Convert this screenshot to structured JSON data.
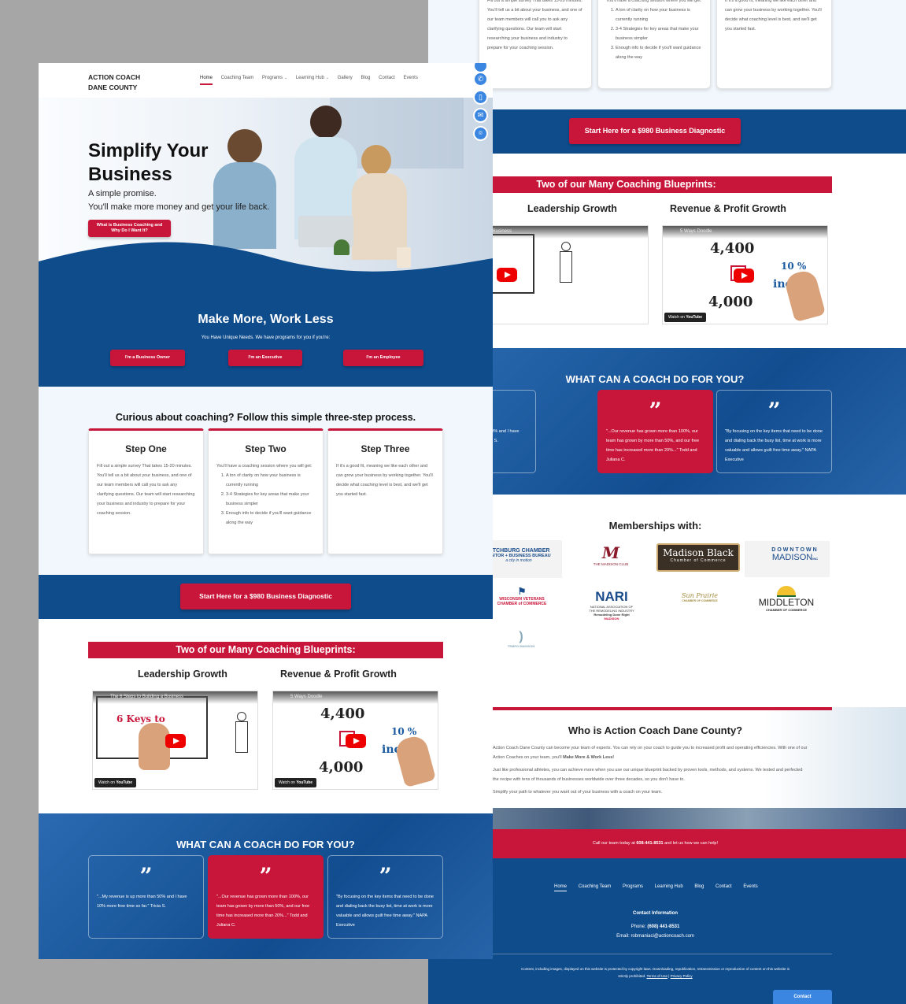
{
  "back": {
    "steps": {
      "step1_text": "Fill out a simple survey That takes 15-20 minutes. You'll tell us a bit about your business, and one of our team members will call you to ask any clarifying questions. Our team will start researching your business and industry to prepare for your coaching session.",
      "step2_intro": "You'll have a coaching session where you will get:",
      "step2_items": [
        "A ton of clarity on how your business is currently running",
        "3-4 Strategies for key areas that make your business simpler",
        "Enough info to decide if you'll want guidance along the way"
      ],
      "step3_text": "If it's a good fit, meaning we like each other and can grow your business by working together. You'll decide what coaching level is best, and we'll get you started fast."
    },
    "cta_button": "Start Here for a $980 Business Diagnostic",
    "blueprints_banner": "Two of our Many Coaching Blueprints:",
    "blueprint_1": "Leadership Growth",
    "blueprint_2": "Revenue & Profit Growth",
    "video1_title": "The 6 Steps to Building a Business",
    "video2_title": "5 Ways Doodle",
    "watch_on": "Watch on",
    "youtube": "YouTube",
    "video_text_keys": "6 Keys to",
    "video_num_top": "4,400",
    "video_num_bottom": "4,000",
    "video_pct": "10 %",
    "video_inc": "inc",
    "coach_heading": "WHAT CAN A COACH DO FOR YOU?",
    "quote1": "\"...My revenue is up more than 50% and I have 10% more free time so far.\" Tricia S.",
    "quote2": "\"...Our revenue has grown more than 100%, our team has grown by more than 50%, and our free time has increased more than 20%...\" Todd and Juliana C.",
    "quote3": "\"By focusing on the key items that need to be done and dialing back the busy list, time at work is more valuable and allows guilt free time away.\" NAPA Executive",
    "memberships_heading": "Memberships with:",
    "logos": [
      "FITCHBURG CHAMBER",
      "VISITOR + BUSINESS BUREAU",
      "a city in motion",
      "THE MADISON CLUB",
      "Madison Black",
      "Chamber of Commerce",
      "DOWNTOWN",
      "MADISON",
      "INC",
      "WISCONSIN VETERANS CHAMBER of COMMERCE",
      "NARI",
      "NATIONAL ASSOCIATION OF THE REMODELING INDUSTRY",
      "Remodeling Done Right",
      "MADISON",
      "Sun Prairie",
      "CHAMBER OF COMMERCE",
      "MIDDLETON",
      "CHAMBER OF COMMERCE",
      "TEMPO MADISON"
    ],
    "who_heading": "Who is Action Coach Dane County?",
    "who_p1a": "Action Coach Dane County can become your team of experts. You can rely on your coach to guide you to increased profit and operating efficiencies. With one of our Action Coaches on your team, you'll",
    "who_p1b": "Make More & Work Less!",
    "who_p2": "Just like professional athletes, you can achieve more when you use our unique blueprint backed by proven tools, methods, and systems. We tested and perfected the recipe with tens of thousands of businesses worldwide over three decades, so you don't have to.",
    "who_p3": "Simplify your path to whatever you want out of your business with a coach on your team.",
    "call_text_a": "Call our team today at",
    "call_phone": "608-441-8531",
    "call_text_b": "and let us how we can help!",
    "footer_nav": [
      "Home",
      "Coaching Team",
      "Programs",
      "Learning Hub",
      "Blog",
      "Contact",
      "Events"
    ],
    "contact_info_heading": "Contact Information",
    "phone_label": "Phone:",
    "phone_value": "(608) 441-8531",
    "email_label": "Email:",
    "email_value": "robmaniaci@actioncoach.com",
    "legal_a": "Content, including images, displayed on this website is protected by copyright laws. Downloading, republication, retransmission or reproduction of content on this website is strictly prohibited.",
    "terms": "Terms of Use",
    "privacy": "Privacy Policy",
    "contact_tab": "Contact"
  },
  "front": {
    "brand_line1": "ACTION COACH",
    "brand_line2": "DANE COUNTY",
    "nav": {
      "home": "Home",
      "team": "Coaching Team",
      "programs": "Programs",
      "learning": "Learning Hub",
      "gallery": "Gallery",
      "blog": "Blog",
      "contact": "Contact",
      "events": "Events"
    },
    "hero_title_1": "Simplify Your",
    "hero_title_2": "Business",
    "hero_sub_1": "A simple promise.",
    "hero_sub_2": "You'll make more money and get your life back.",
    "hero_btn_1": "What is Business Coaching and",
    "hero_btn_2": "Why Do I Want It?",
    "mm_heading": "Make More, Work Less",
    "mm_sub": "You Have Unique Needs. We have programs for you if you're:",
    "btn_owner": "I'm a Business Owner",
    "btn_exec": "I'm an Executive",
    "btn_emp": "I'm an Employee",
    "process_heading": "Curious about coaching? Follow this simple three-step process.",
    "step1_title": "Step One",
    "step2_title": "Step Two",
    "step3_title": "Step Three",
    "cta": "Start Here for a $980 Business Diagnostic",
    "blueprints_banner": "Two of our Many Coaching Blueprints:",
    "blueprint_1": "Leadership Growth",
    "blueprint_2": "Revenue & Profit Growth",
    "coach_heading": "WHAT CAN A COACH DO FOR YOU?"
  },
  "colors": {
    "brand_blue": "#0f4c8c",
    "brand_red": "#c8163a",
    "fab_blue": "#3a86e0"
  },
  "icons": [
    "phone-icon",
    "document-icon",
    "email-icon",
    "location-icon",
    "chevron-down-icon",
    "youtube-play-icon",
    "quote-icon"
  ]
}
